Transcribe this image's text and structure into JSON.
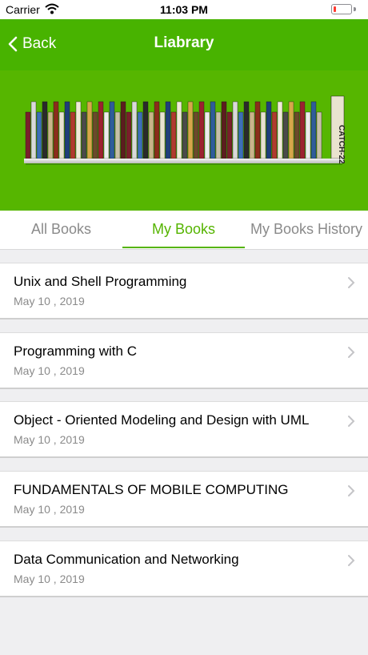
{
  "status_bar": {
    "carrier": "Carrier",
    "time": "11:03 PM",
    "wifi_icon": "wifi-icon",
    "battery_icon": "battery-low-icon",
    "battery_color": "#ff3b30"
  },
  "nav": {
    "back_label": "Back",
    "title": "Liabrary",
    "background": "#48b300"
  },
  "banner": {
    "image": "bookshelf-illustration",
    "book_spine_labels": [
      "CATCH-22"
    ]
  },
  "tabs": [
    {
      "label": "All Books",
      "active": false
    },
    {
      "label": "My Books",
      "active": true
    },
    {
      "label": "My Books History",
      "active": false
    }
  ],
  "accent_color": "#55b400",
  "books": [
    {
      "title": "Unix and Shell Programming",
      "date": "May 10 , 2019"
    },
    {
      "title": "Programming with C",
      "date": "May 10 , 2019"
    },
    {
      "title": "Object - Oriented Modeling and Design with UML",
      "date": "May 10 , 2019"
    },
    {
      "title": "FUNDAMENTALS OF MOBILE COMPUTING",
      "date": "May 10 , 2019"
    },
    {
      "title": "Data Communication and Networking",
      "date": "May 10 , 2019"
    }
  ]
}
